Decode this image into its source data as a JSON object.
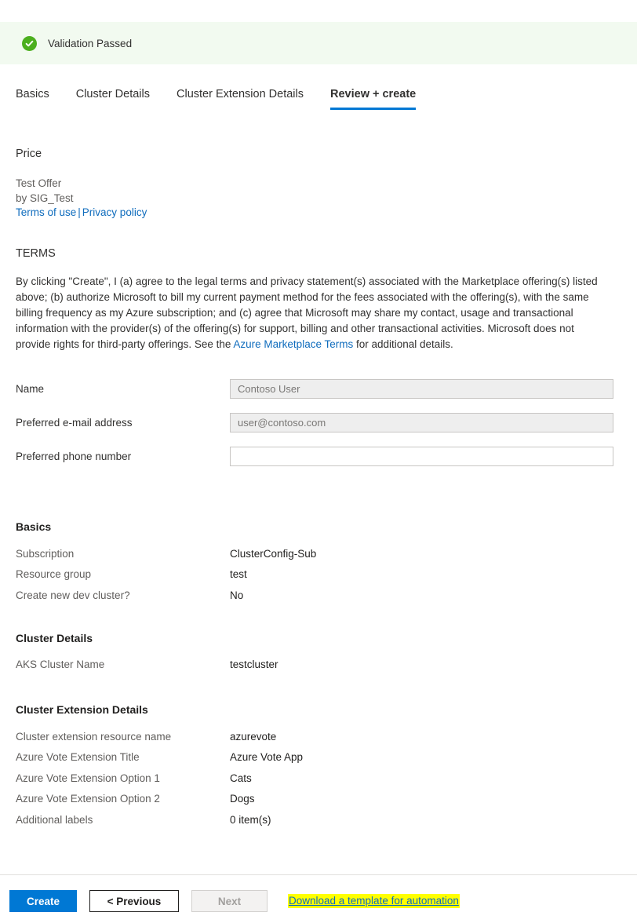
{
  "banner": {
    "icon": "check-circle-icon",
    "message": "Validation Passed",
    "background": "#f2faf0",
    "icon_color": "#4caf1e"
  },
  "tabs": [
    {
      "label": "Basics",
      "active": false
    },
    {
      "label": "Cluster Details",
      "active": false
    },
    {
      "label": "Cluster Extension Details",
      "active": false
    },
    {
      "label": "Review + create",
      "active": true
    }
  ],
  "price": {
    "heading": "Price",
    "offer_name": "Test Offer",
    "publisher": "by SIG_Test",
    "terms_of_use_link": "Terms of use",
    "separator": "|",
    "privacy_policy_link": "Privacy policy"
  },
  "terms": {
    "heading": "TERMS",
    "body_part1": "By clicking \"Create\", I (a) agree to the legal terms and privacy statement(s) associated with the Marketplace offering(s) listed above; (b) authorize Microsoft to bill my current payment method for the fees associated with the offering(s), with the same billing frequency as my Azure subscription; and (c) agree that Microsoft may share my contact, usage and transactional information with the provider(s) of the offering(s) for support, billing and other transactional activities. Microsoft does not provide rights for third-party offerings. See the ",
    "inline_link": "Azure Marketplace Terms",
    "body_part2": " for additional details."
  },
  "form": {
    "name": {
      "label": "Name",
      "value": "Contoso User",
      "placeholder": "Contoso User",
      "disabled": true
    },
    "email": {
      "label": "Preferred e-mail address",
      "value": "user@contoso.com",
      "placeholder": "user@contoso.com",
      "disabled": true
    },
    "phone": {
      "label": "Preferred phone number",
      "value": "",
      "placeholder": "",
      "disabled": false
    }
  },
  "summary": [
    {
      "heading": "Basics",
      "rows": [
        {
          "key": "Subscription",
          "value": "ClusterConfig-Sub"
        },
        {
          "key": "Resource group",
          "value": "test"
        },
        {
          "key": "Create new dev cluster?",
          "value": "No"
        }
      ]
    },
    {
      "heading": "Cluster Details",
      "rows": [
        {
          "key": "AKS Cluster Name",
          "value": "testcluster"
        }
      ]
    },
    {
      "heading": "Cluster Extension Details",
      "rows": [
        {
          "key": "Cluster extension resource name",
          "value": "azurevote"
        },
        {
          "key": "Azure Vote Extension Title",
          "value": "Azure Vote App"
        },
        {
          "key": "Azure Vote Extension Option 1",
          "value": "Cats"
        },
        {
          "key": "Azure Vote Extension Option 2",
          "value": "Dogs"
        },
        {
          "key": "Additional labels",
          "value": "0 item(s)"
        }
      ]
    }
  ],
  "footer": {
    "create_label": "Create",
    "previous_label": "< Previous",
    "next_label": "Next",
    "next_disabled": true,
    "download_template_label": "Download a template for automation",
    "highlight_color": "#ffff00",
    "primary_color": "#0078d4"
  }
}
